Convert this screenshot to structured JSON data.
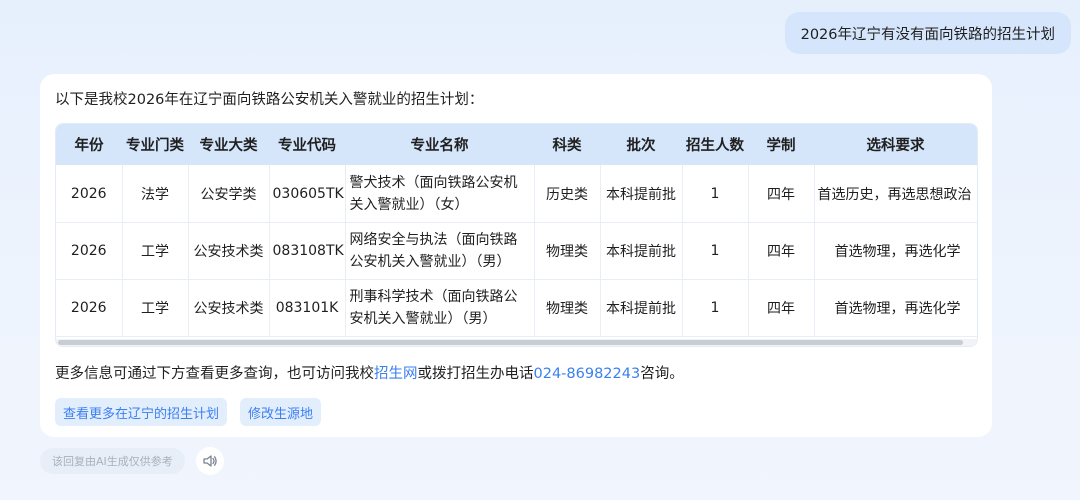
{
  "user_message": "2026年辽宁有没有面向铁路的招生计划",
  "answer": {
    "intro": "以下是我校2026年在辽宁面向铁路公安机关入警就业的招生计划：",
    "table": {
      "headers": [
        "年份",
        "专业门类",
        "专业大类",
        "专业代码",
        "专业名称",
        "科类",
        "批次",
        "招生人数",
        "学制",
        "选科要求"
      ],
      "rows": [
        [
          "2026",
          "法学",
          "公安学类",
          "030605TK",
          "警犬技术（面向铁路公安机关入警就业）（女）",
          "历史类",
          "本科提前批",
          "1",
          "四年",
          "首选历史，再选思想政治"
        ],
        [
          "2026",
          "工学",
          "公安技术类",
          "083108TK",
          "网络安全与执法（面向铁路公安机关入警就业）（男）",
          "物理类",
          "本科提前批",
          "1",
          "四年",
          "首选物理，再选化学"
        ],
        [
          "2026",
          "工学",
          "公安技术类",
          "083101K",
          "刑事科学技术（面向铁路公安机关入警就业）（男）",
          "物理类",
          "本科提前批",
          "1",
          "四年",
          "首选物理，再选化学"
        ]
      ]
    },
    "info": {
      "prefix": "更多信息可通过下方查看更多查询，也可访问我校",
      "link_site": "招生网",
      "middle": "或拨打招生办电话",
      "phone": "024-86982243",
      "suffix": "咨询。"
    },
    "actions": {
      "more_plans": "查看更多在辽宁的招生计划",
      "change_origin": "修改生源地"
    }
  },
  "disclaimer": "该回复由AI生成仅供参考",
  "icons": {
    "speaker": "speaker-icon"
  },
  "colors": {
    "accent": "#3b7ff0",
    "header_bg": "#d5e6fb",
    "user_bubble": "#d5e6fc"
  }
}
